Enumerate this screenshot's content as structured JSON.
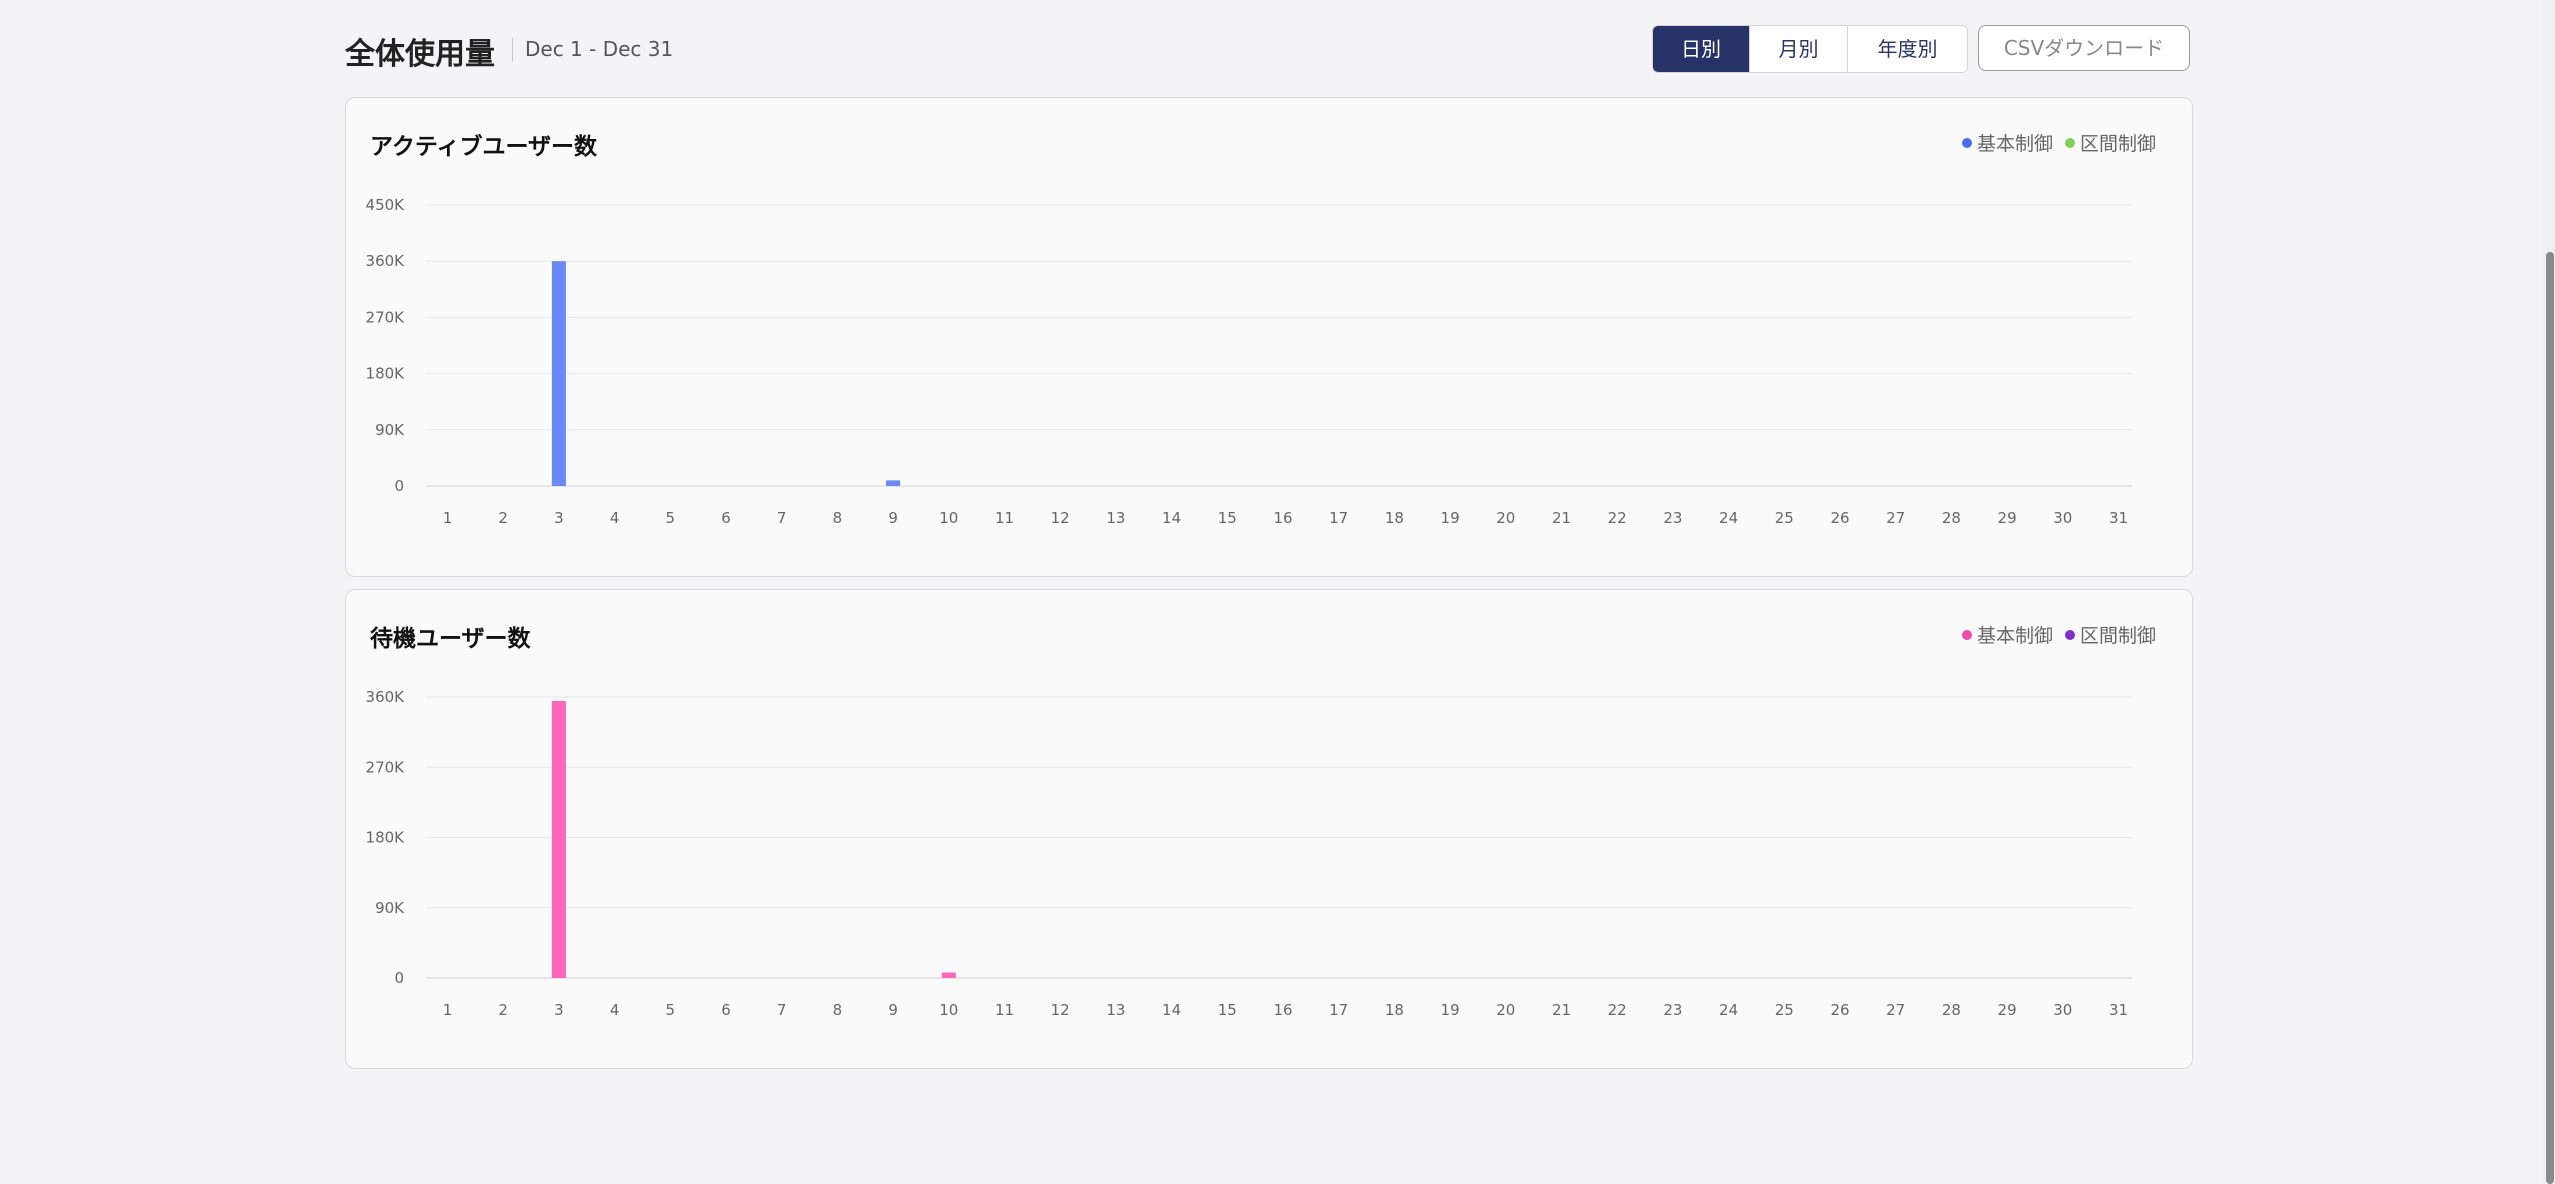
{
  "header": {
    "title": "全体使用量",
    "date_range": "Dec 1 - Dec 31",
    "tabs": [
      {
        "label": "日別",
        "active": true
      },
      {
        "label": "月別",
        "active": false
      },
      {
        "label": "年度別",
        "active": false
      }
    ],
    "csv_label": "CSVダウンロード"
  },
  "charts": [
    {
      "title": "アクティブユーザー数",
      "legend": [
        {
          "label": "基本制御",
          "color": "#4a6ef0"
        },
        {
          "label": "区間制御",
          "color": "#7fcf5a"
        }
      ]
    },
    {
      "title": "待機ユーザー数",
      "legend": [
        {
          "label": "基本制御",
          "color": "#f24aa8"
        },
        {
          "label": "区間制御",
          "color": "#7b2fc7"
        }
      ]
    }
  ],
  "chart_data": [
    {
      "type": "bar",
      "title": "アクティブユーザー数",
      "categories": [
        "1",
        "2",
        "3",
        "4",
        "5",
        "6",
        "7",
        "8",
        "9",
        "10",
        "11",
        "12",
        "13",
        "14",
        "15",
        "16",
        "17",
        "18",
        "19",
        "20",
        "21",
        "22",
        "23",
        "24",
        "25",
        "26",
        "27",
        "28",
        "29",
        "30",
        "31"
      ],
      "yticks": [
        "0",
        "90K",
        "180K",
        "270K",
        "360K",
        "450K"
      ],
      "ylim": [
        0,
        450000
      ],
      "grid": true,
      "legend_position": "top-right",
      "bar_color": "#6b88f7",
      "series": [
        {
          "name": "基本制御",
          "values": [
            0,
            0,
            360000,
            0,
            0,
            0,
            0,
            0,
            9000,
            0,
            0,
            0,
            0,
            0,
            0,
            0,
            0,
            0,
            0,
            0,
            0,
            0,
            0,
            0,
            0,
            0,
            0,
            0,
            0,
            0,
            0
          ]
        },
        {
          "name": "区間制御",
          "values": [
            0,
            0,
            0,
            0,
            0,
            0,
            0,
            0,
            0,
            0,
            0,
            0,
            0,
            0,
            0,
            0,
            0,
            0,
            0,
            0,
            0,
            0,
            0,
            0,
            0,
            0,
            0,
            0,
            0,
            0,
            0
          ]
        }
      ]
    },
    {
      "type": "bar",
      "title": "待機ユーザー数",
      "categories": [
        "1",
        "2",
        "3",
        "4",
        "5",
        "6",
        "7",
        "8",
        "9",
        "10",
        "11",
        "12",
        "13",
        "14",
        "15",
        "16",
        "17",
        "18",
        "19",
        "20",
        "21",
        "22",
        "23",
        "24",
        "25",
        "26",
        "27",
        "28",
        "29",
        "30",
        "31"
      ],
      "yticks": [
        "0",
        "90K",
        "180K",
        "270K",
        "360K"
      ],
      "ylim": [
        0,
        360000
      ],
      "grid": true,
      "legend_position": "top-right",
      "bar_color": "#ff66bb",
      "series": [
        {
          "name": "基本制御",
          "values": [
            0,
            0,
            355000,
            0,
            0,
            0,
            0,
            0,
            0,
            7000,
            0,
            0,
            0,
            0,
            0,
            0,
            0,
            0,
            0,
            0,
            0,
            0,
            0,
            0,
            0,
            0,
            0,
            0,
            0,
            0,
            0
          ]
        },
        {
          "name": "区間制御",
          "values": [
            0,
            0,
            0,
            0,
            0,
            0,
            0,
            0,
            0,
            0,
            0,
            0,
            0,
            0,
            0,
            0,
            0,
            0,
            0,
            0,
            0,
            0,
            0,
            0,
            0,
            0,
            0,
            0,
            0,
            0,
            0
          ]
        }
      ]
    }
  ]
}
